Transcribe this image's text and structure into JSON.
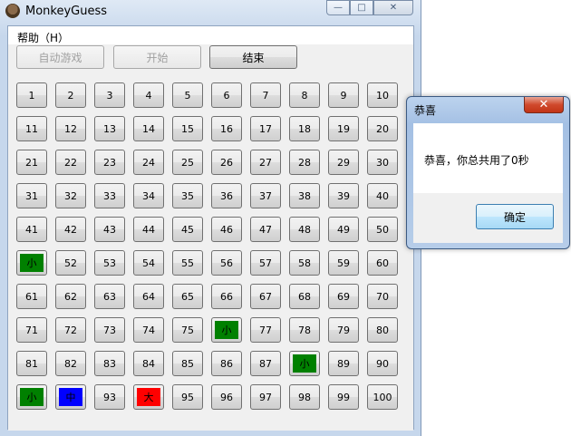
{
  "window": {
    "title": "MonkeyGuess",
    "min_glyph": "—",
    "max_glyph": "□",
    "close_glyph": "✕"
  },
  "menu": {
    "help": "帮助（H）"
  },
  "toolbar": {
    "auto_play": "自动游戏",
    "start": "开始",
    "end": "结束"
  },
  "grid": {
    "cells": [
      {
        "label": "1"
      },
      {
        "label": "2"
      },
      {
        "label": "3"
      },
      {
        "label": "4"
      },
      {
        "label": "5"
      },
      {
        "label": "6"
      },
      {
        "label": "7"
      },
      {
        "label": "8"
      },
      {
        "label": "9"
      },
      {
        "label": "10"
      },
      {
        "label": "11"
      },
      {
        "label": "12"
      },
      {
        "label": "13"
      },
      {
        "label": "14"
      },
      {
        "label": "15"
      },
      {
        "label": "16"
      },
      {
        "label": "17"
      },
      {
        "label": "18"
      },
      {
        "label": "19"
      },
      {
        "label": "20"
      },
      {
        "label": "21"
      },
      {
        "label": "22"
      },
      {
        "label": "23"
      },
      {
        "label": "24"
      },
      {
        "label": "25"
      },
      {
        "label": "26"
      },
      {
        "label": "27"
      },
      {
        "label": "28"
      },
      {
        "label": "29"
      },
      {
        "label": "30"
      },
      {
        "label": "31"
      },
      {
        "label": "32"
      },
      {
        "label": "33"
      },
      {
        "label": "34"
      },
      {
        "label": "35"
      },
      {
        "label": "36"
      },
      {
        "label": "37"
      },
      {
        "label": "38"
      },
      {
        "label": "39"
      },
      {
        "label": "40"
      },
      {
        "label": "41"
      },
      {
        "label": "42"
      },
      {
        "label": "43"
      },
      {
        "label": "44"
      },
      {
        "label": "45"
      },
      {
        "label": "46"
      },
      {
        "label": "47"
      },
      {
        "label": "48"
      },
      {
        "label": "49"
      },
      {
        "label": "50"
      },
      {
        "label": "小",
        "color": "#008000"
      },
      {
        "label": "52"
      },
      {
        "label": "53"
      },
      {
        "label": "54"
      },
      {
        "label": "55"
      },
      {
        "label": "56"
      },
      {
        "label": "57"
      },
      {
        "label": "58"
      },
      {
        "label": "59"
      },
      {
        "label": "60"
      },
      {
        "label": "61"
      },
      {
        "label": "62"
      },
      {
        "label": "63"
      },
      {
        "label": "64"
      },
      {
        "label": "65"
      },
      {
        "label": "66"
      },
      {
        "label": "67"
      },
      {
        "label": "68"
      },
      {
        "label": "69"
      },
      {
        "label": "70"
      },
      {
        "label": "71"
      },
      {
        "label": "72"
      },
      {
        "label": "73"
      },
      {
        "label": "74"
      },
      {
        "label": "75"
      },
      {
        "label": "小",
        "color": "#008000"
      },
      {
        "label": "77"
      },
      {
        "label": "78"
      },
      {
        "label": "79"
      },
      {
        "label": "80"
      },
      {
        "label": "81"
      },
      {
        "label": "82"
      },
      {
        "label": "83"
      },
      {
        "label": "84"
      },
      {
        "label": "85"
      },
      {
        "label": "86"
      },
      {
        "label": "87"
      },
      {
        "label": "小",
        "color": "#008000"
      },
      {
        "label": "89"
      },
      {
        "label": "90"
      },
      {
        "label": "小",
        "color": "#008000"
      },
      {
        "label": "中",
        "color": "#0000ff"
      },
      {
        "label": "93"
      },
      {
        "label": "大",
        "color": "#ff0000"
      },
      {
        "label": "95"
      },
      {
        "label": "96"
      },
      {
        "label": "97"
      },
      {
        "label": "98"
      },
      {
        "label": "99"
      },
      {
        "label": "100"
      }
    ]
  },
  "dialog": {
    "title": "恭喜",
    "message": "恭喜，你总共用了0秒",
    "ok": "确定",
    "close_glyph": "✕"
  }
}
